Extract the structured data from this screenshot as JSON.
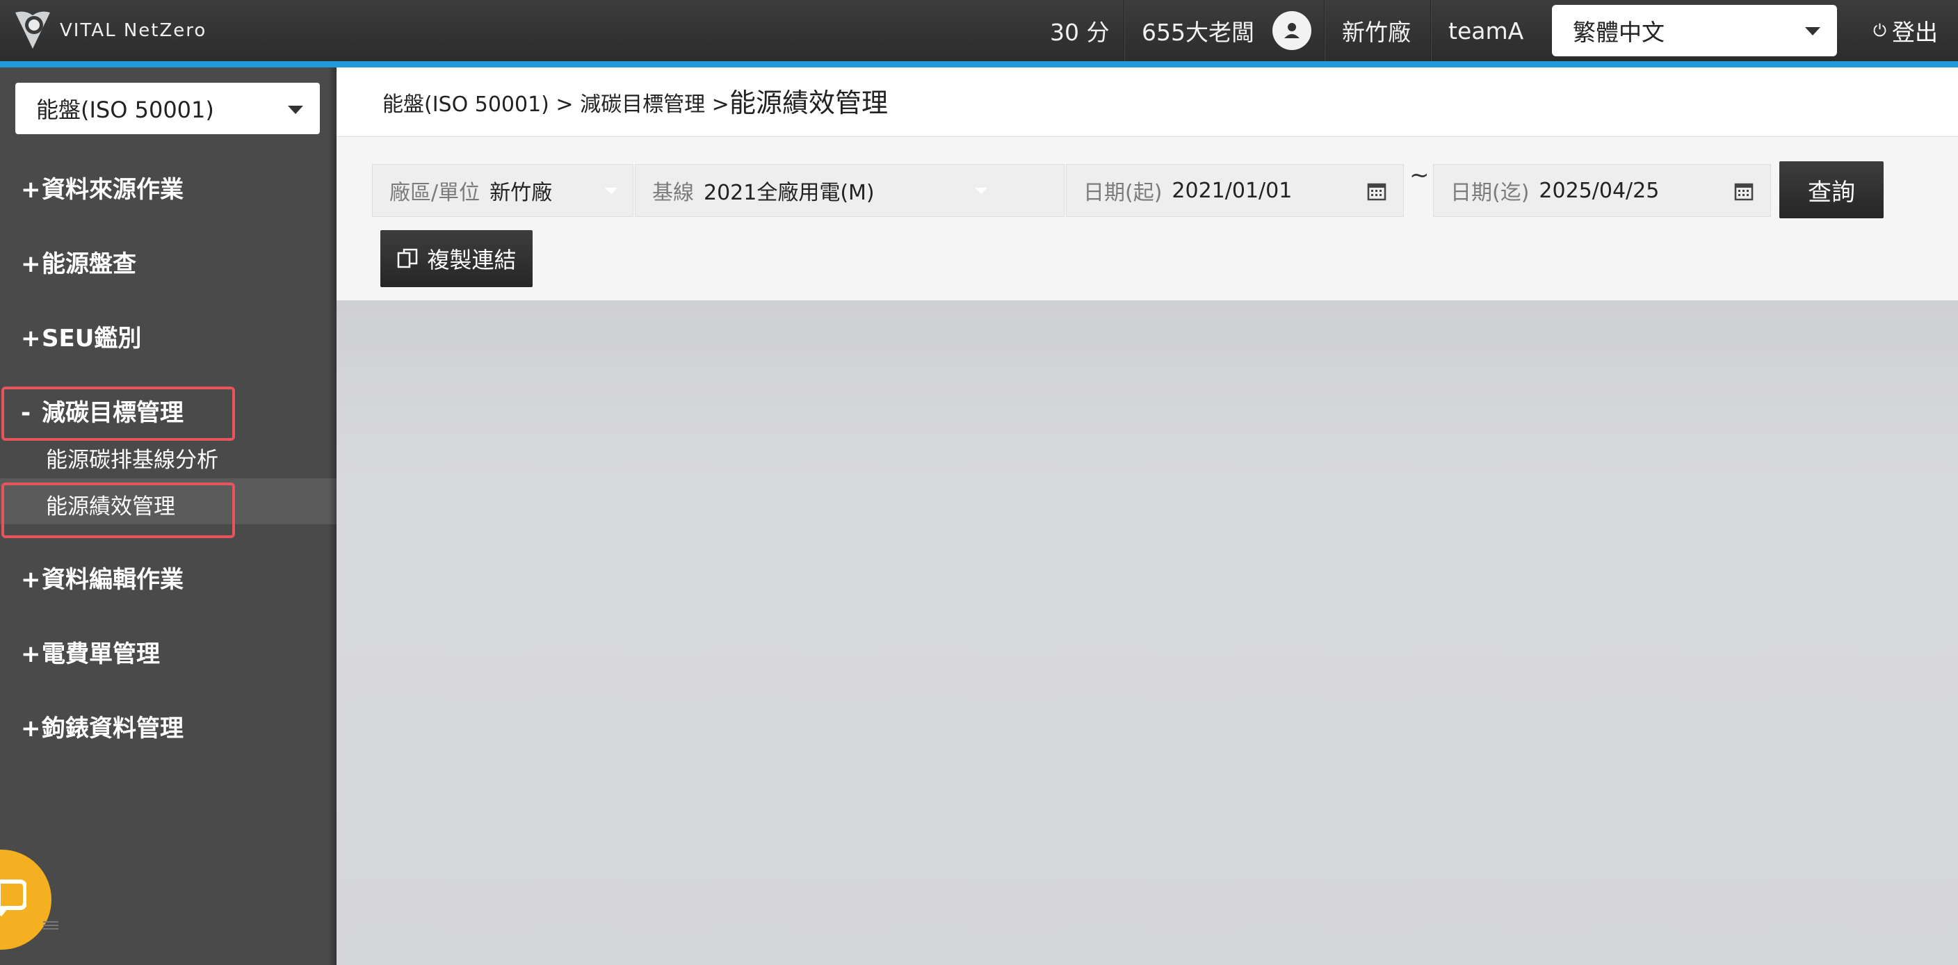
{
  "header": {
    "logo_text": "VITAL NetZero",
    "score": "30 分",
    "user_name": "655大老闆",
    "site": "新竹廠",
    "team": "teamA",
    "language": "繁體中文",
    "logout_label": "登出"
  },
  "sidebar": {
    "module_select": "能盤(ISO 50001)",
    "menu": [
      {
        "sign": "+",
        "label": "資料來源作業"
      },
      {
        "sign": "+",
        "label": "能源盤查"
      },
      {
        "sign": "+",
        "label": "SEU鑑別"
      },
      {
        "sign": "-",
        "label": "減碳目標管理"
      },
      {
        "sign": "+",
        "label": "資料編輯作業"
      },
      {
        "sign": "+",
        "label": "電費單管理"
      },
      {
        "sign": "+",
        "label": "鉤錶資料管理"
      }
    ],
    "submenu": [
      {
        "label": "能源碳排基線分析"
      },
      {
        "label": "能源績效管理"
      }
    ]
  },
  "breadcrumb": {
    "path": "能盤(ISO 50001) > 減碳目標管理 >",
    "current": "能源績效管理"
  },
  "filters": {
    "site_label": "廠區/單位",
    "site_value": "新竹廠",
    "baseline_label": "基線",
    "baseline_value": "2021全廠用電(M)",
    "start_label": "日期(起)",
    "start_value": "2021/01/01",
    "separator": "~",
    "end_label": "日期(迄)",
    "end_value": "2025/04/25",
    "query_label": "查詢",
    "copy_link_label": "複製連結"
  },
  "colors": {
    "accent": "#1f9ad9",
    "highlight": "#e5555b",
    "chat": "#f5b021"
  }
}
